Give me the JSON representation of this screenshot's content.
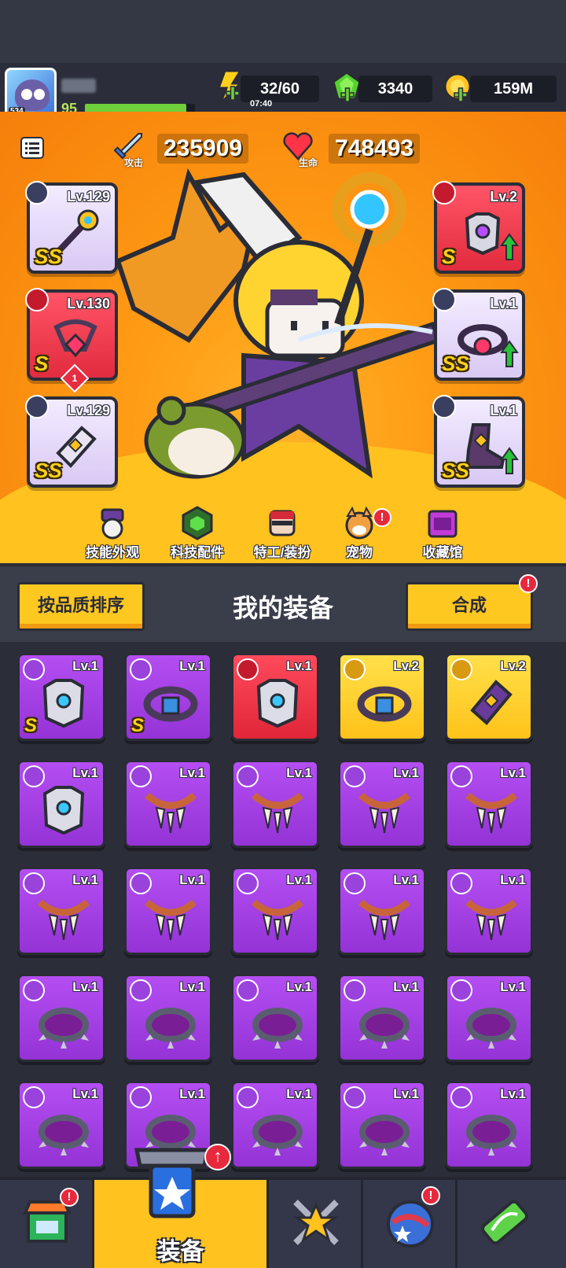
{
  "player": {
    "level": "95",
    "avatar_badge": "534",
    "xp_fraction": 0.92
  },
  "resources": {
    "energy": {
      "value": "32/60",
      "timer": "07:40",
      "icon": "lightning-icon"
    },
    "gems": {
      "value": "3340",
      "icon": "green-gem-icon"
    },
    "coins": {
      "value": "159M",
      "icon": "gold-coin-icon"
    }
  },
  "stats": {
    "attack": {
      "label": "攻击",
      "value": "235909"
    },
    "hp": {
      "label": "生命",
      "value": "748493"
    }
  },
  "equipped": {
    "left": [
      {
        "level": "Lv.129",
        "rank": "SS",
        "type": "weapon"
      },
      {
        "level": "Lv.130",
        "rank": "S",
        "type": "necklace",
        "stars": "1"
      },
      {
        "level": "Lv.129",
        "rank": "SS",
        "type": "glove"
      }
    ],
    "right": [
      {
        "level": "Lv.2",
        "rank": "S",
        "type": "armor",
        "upgradable": true
      },
      {
        "level": "Lv.1",
        "rank": "SS",
        "type": "belt",
        "upgradable": true
      },
      {
        "level": "Lv.1",
        "rank": "SS",
        "type": "boots",
        "upgradable": true
      }
    ]
  },
  "nav": [
    {
      "label": "技能外观",
      "icon": "skill-skin-icon"
    },
    {
      "label": "科技配件",
      "icon": "tech-part-icon"
    },
    {
      "label": "特工/装扮",
      "icon": "agent-costume-icon"
    },
    {
      "label": "宠物",
      "icon": "pet-icon",
      "alert": "!"
    },
    {
      "label": "收藏馆",
      "icon": "collection-icon"
    }
  ],
  "panel": {
    "sort_label": "按品质排序",
    "title": "我的装备",
    "merge_label": "合成",
    "merge_alert": "!"
  },
  "inventory": [
    {
      "level": "Lv.1",
      "rank": "S",
      "quality": "purple",
      "type": "armor"
    },
    {
      "level": "Lv.1",
      "rank": "S",
      "quality": "purple",
      "type": "belt"
    },
    {
      "level": "Lv.1",
      "rank": "",
      "quality": "red",
      "type": "armor"
    },
    {
      "level": "Lv.2",
      "rank": "",
      "quality": "gold",
      "type": "belt"
    },
    {
      "level": "Lv.2",
      "rank": "",
      "quality": "gold",
      "type": "glove"
    },
    {
      "level": "Lv.1",
      "rank": "",
      "quality": "purple",
      "type": "armor"
    },
    {
      "level": "Lv.1",
      "rank": "",
      "quality": "purple",
      "type": "fang-necklace"
    },
    {
      "level": "Lv.1",
      "rank": "",
      "quality": "purple",
      "type": "fang-necklace"
    },
    {
      "level": "Lv.1",
      "rank": "",
      "quality": "purple",
      "type": "fang-necklace"
    },
    {
      "level": "Lv.1",
      "rank": "",
      "quality": "purple",
      "type": "fang-necklace"
    },
    {
      "level": "Lv.1",
      "rank": "",
      "quality": "purple",
      "type": "fang-necklace"
    },
    {
      "level": "Lv.1",
      "rank": "",
      "quality": "purple",
      "type": "fang-necklace"
    },
    {
      "level": "Lv.1",
      "rank": "",
      "quality": "purple",
      "type": "fang-necklace"
    },
    {
      "level": "Lv.1",
      "rank": "",
      "quality": "purple",
      "type": "fang-necklace"
    },
    {
      "level": "Lv.1",
      "rank": "",
      "quality": "purple",
      "type": "fang-necklace"
    },
    {
      "level": "Lv.1",
      "rank": "",
      "quality": "purple",
      "type": "spike-collar"
    },
    {
      "level": "Lv.1",
      "rank": "",
      "quality": "purple",
      "type": "spike-collar"
    },
    {
      "level": "Lv.1",
      "rank": "",
      "quality": "purple",
      "type": "spike-collar"
    },
    {
      "level": "Lv.1",
      "rank": "",
      "quality": "purple",
      "type": "spike-collar"
    },
    {
      "level": "Lv.1",
      "rank": "",
      "quality": "purple",
      "type": "spike-collar"
    },
    {
      "level": "Lv.1",
      "rank": "",
      "quality": "purple",
      "type": "spike-collar"
    },
    {
      "level": "Lv.1",
      "rank": "",
      "quality": "purple",
      "type": "spike-collar"
    },
    {
      "level": "Lv.1",
      "rank": "",
      "quality": "purple",
      "type": "spike-collar"
    },
    {
      "level": "Lv.1",
      "rank": "",
      "quality": "purple",
      "type": "spike-collar"
    },
    {
      "level": "Lv.1",
      "rank": "",
      "quality": "purple",
      "type": "spike-collar"
    }
  ],
  "tabs": [
    {
      "label": "",
      "icon": "shop-icon",
      "alert": "!"
    },
    {
      "label": "装备",
      "icon": "equipment-icon",
      "active": true,
      "alert": "↑"
    },
    {
      "label": "",
      "icon": "star-swords-icon"
    },
    {
      "label": "",
      "icon": "world-icon",
      "alert": "!"
    },
    {
      "label": "",
      "icon": "dna-icon"
    }
  ],
  "colors": {
    "hero_bg": "#ff9b14",
    "purple": "#a540e6",
    "red": "#ec3346",
    "gold": "#ffc81f",
    "panel_bg": "#3a3d4a"
  }
}
